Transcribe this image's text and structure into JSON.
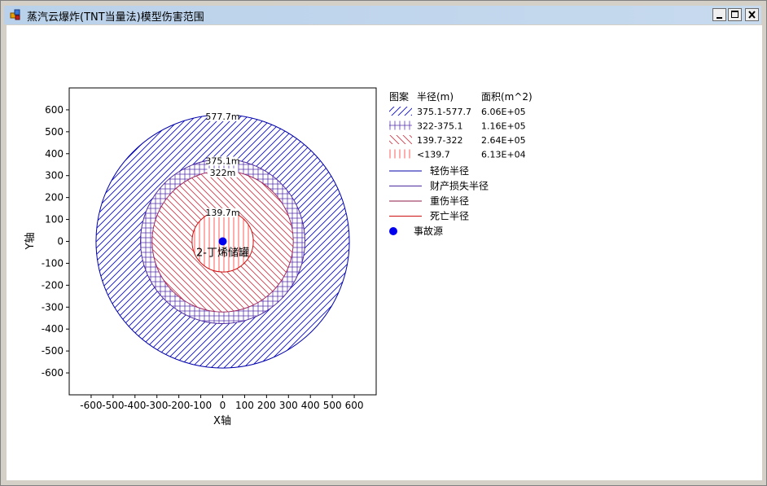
{
  "window": {
    "title": "蒸汽云爆炸(TNT当量法)模型伤害范围",
    "controls": [
      "minimize",
      "maximize",
      "close"
    ]
  },
  "chart_data": {
    "type": "circle-zones",
    "xlabel": "X轴",
    "ylabel": "Y轴",
    "xlim": [
      -700,
      700
    ],
    "ylim": [
      -700,
      700
    ],
    "xticks": [
      -600,
      -500,
      -400,
      -300,
      -200,
      -100,
      0,
      100,
      200,
      300,
      400,
      500,
      600
    ],
    "yticks": [
      600,
      500,
      400,
      300,
      200,
      100,
      0,
      -100,
      -200,
      -300,
      -400,
      -500,
      -600
    ],
    "xtick_labels": [
      "-600",
      "-500",
      "-400",
      "-300",
      "-200",
      "-100",
      "0",
      "100",
      "200",
      "300",
      "400",
      "500",
      "600"
    ],
    "ytick_labels": [
      "600",
      "500",
      "400",
      "300",
      "200",
      "100",
      "0",
      "-100",
      "-200",
      "-300",
      "-400",
      "-500",
      "-600"
    ],
    "circles": [
      {
        "radius": 577.7,
        "label": "577.7m",
        "color": "#0000aa",
        "pattern": "hatch-blue"
      },
      {
        "radius": 375.1,
        "label": "375.1m",
        "color": "#4b2a9e",
        "pattern": "grid-purple"
      },
      {
        "radius": 322,
        "label": "322m",
        "color": "#9c2a63",
        "pattern": "hatch-red"
      },
      {
        "radius": 139.7,
        "label": "139.7m",
        "color": "#cc1111",
        "pattern": "vlines-red"
      }
    ],
    "source": {
      "x": 0,
      "y": 0,
      "label": "2-丁烯储罐",
      "color": "#0000ee"
    },
    "legend": {
      "headers": [
        "图案",
        "半径(m)",
        "面积(m^2)"
      ],
      "pattern_rows": [
        {
          "pattern": "hatch-blue",
          "range": "375.1-577.7",
          "area": "6.06E+05"
        },
        {
          "pattern": "grid-purple",
          "range": "322-375.1",
          "area": "1.16E+05"
        },
        {
          "pattern": "hatch-red",
          "range": "139.7-322",
          "area": "2.64E+05"
        },
        {
          "pattern": "vlines-red",
          "range": "<139.7",
          "area": "6.13E+04"
        }
      ],
      "line_rows": [
        {
          "color": "#0000aa",
          "label": "轻伤半径"
        },
        {
          "color": "#4b2a9e",
          "label": "财产损失半径"
        },
        {
          "color": "#8b1a4a",
          "label": "重伤半径"
        },
        {
          "color": "#cc1111",
          "label": "死亡半径"
        }
      ],
      "marker_row": {
        "color": "#0000ee",
        "label": "事故源"
      }
    }
  }
}
